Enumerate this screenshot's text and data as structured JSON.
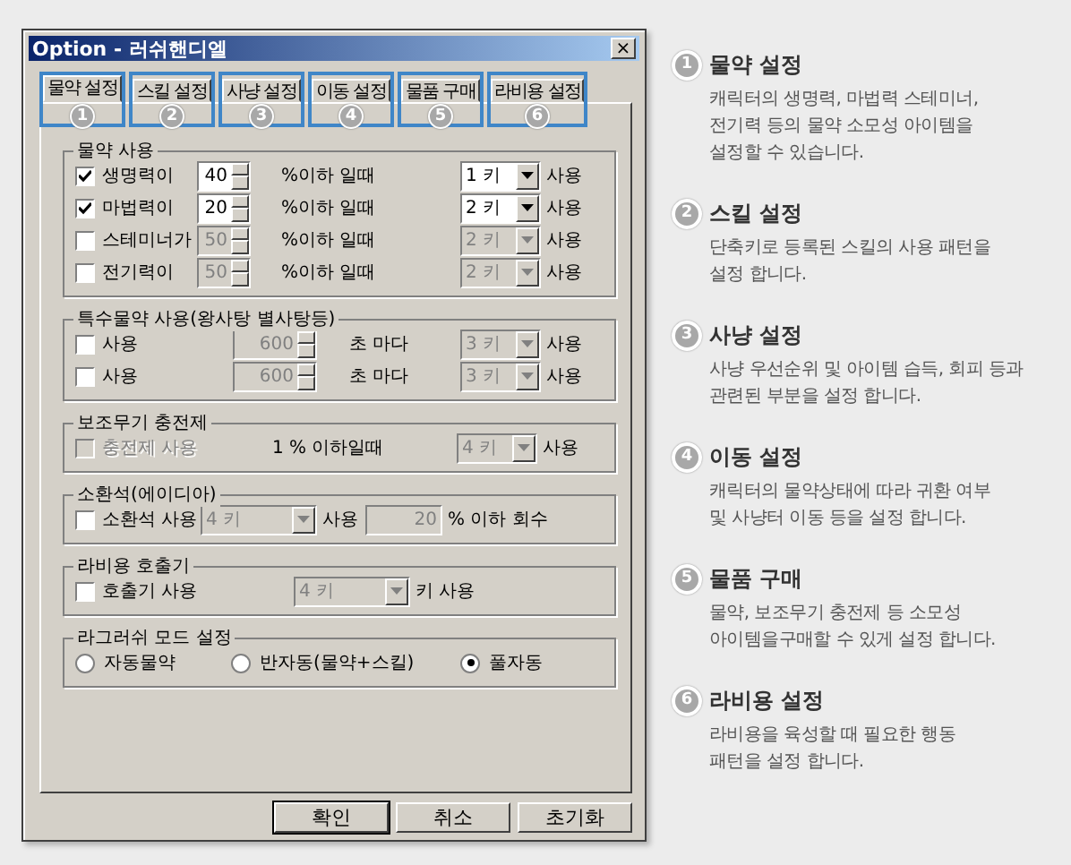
{
  "window": {
    "title": "Option - 러쉬핸디엘",
    "close": "×"
  },
  "tabs": [
    {
      "label": "물약 설정",
      "number": "1",
      "selected": true
    },
    {
      "label": "스킬 설정",
      "number": "2",
      "selected": false
    },
    {
      "label": "사냥 설정",
      "number": "3",
      "selected": false
    },
    {
      "label": "이동 설정",
      "number": "4",
      "selected": false
    },
    {
      "label": "물품 구매",
      "number": "5",
      "selected": false
    },
    {
      "label": "라비용 설정",
      "number": "6",
      "selected": false
    }
  ],
  "groups": [
    {
      "title": "물약 사용",
      "kind": "threshold",
      "rows": [
        {
          "items": [
            {
              "kind": "check",
              "label": "생명력이",
              "checked": true,
              "disabled": false
            },
            {
              "kind": "spin",
              "value": "40",
              "disabled": false
            },
            {
              "kind": "text",
              "text": "%이하 일때"
            },
            {
              "kind": "combo",
              "value": "1 키",
              "disabled": false
            },
            {
              "kind": "text",
              "text": "사용"
            }
          ]
        },
        {
          "items": [
            {
              "kind": "check",
              "label": "마법력이",
              "checked": true,
              "disabled": false
            },
            {
              "kind": "spin",
              "value": "20",
              "disabled": false
            },
            {
              "kind": "text",
              "text": "%이하 일때"
            },
            {
              "kind": "combo",
              "value": "2 키",
              "disabled": false
            },
            {
              "kind": "text",
              "text": "사용"
            }
          ]
        },
        {
          "items": [
            {
              "kind": "check",
              "label": "스테미너가",
              "checked": false,
              "disabled": false
            },
            {
              "kind": "spin",
              "value": "50",
              "disabled": true
            },
            {
              "kind": "text",
              "text": "%이하 일때"
            },
            {
              "kind": "combo",
              "value": "2 키",
              "disabled": true
            },
            {
              "kind": "text",
              "text": "사용"
            }
          ]
        },
        {
          "items": [
            {
              "kind": "check",
              "label": "전기력이",
              "checked": false,
              "disabled": false
            },
            {
              "kind": "spin",
              "value": "50",
              "disabled": true
            },
            {
              "kind": "text",
              "text": "%이하 일때"
            },
            {
              "kind": "combo",
              "value": "2 키",
              "disabled": true
            },
            {
              "kind": "text",
              "text": "사용"
            }
          ]
        }
      ]
    },
    {
      "title": "특수물약 사용(왕사탕 별사탕등)",
      "kind": "timer",
      "rows": [
        {
          "items": [
            {
              "kind": "check",
              "label": "사용",
              "checked": false,
              "disabled": false
            },
            {
              "kind": "spin",
              "value": "600",
              "disabled": true
            },
            {
              "kind": "text",
              "text": "초 마다"
            },
            {
              "kind": "combo",
              "value": "3 키",
              "disabled": true
            },
            {
              "kind": "text",
              "text": "사용"
            }
          ]
        },
        {
          "items": [
            {
              "kind": "check",
              "label": "사용",
              "checked": false,
              "disabled": false
            },
            {
              "kind": "spin",
              "value": "600",
              "disabled": true
            },
            {
              "kind": "text",
              "text": "초 마다"
            },
            {
              "kind": "combo",
              "value": "3 키",
              "disabled": true
            },
            {
              "kind": "text",
              "text": "사용"
            }
          ]
        }
      ]
    },
    {
      "title": "보조무기 충전제",
      "kind": "charge",
      "rows": [
        {
          "items": [
            {
              "kind": "check",
              "label": "충전제 사용",
              "checked": false,
              "disabled": true
            },
            {
              "kind": "text",
              "text": "1 % 이하일때"
            },
            {
              "kind": "combo",
              "value": "4 키",
              "disabled": true
            },
            {
              "kind": "text",
              "text": "사용"
            }
          ]
        }
      ]
    },
    {
      "title": "소환석(에이디아)",
      "kind": "summon",
      "rows": [
        {
          "items": [
            {
              "kind": "check",
              "label": "소환석 사용",
              "checked": false,
              "disabled": false
            },
            {
              "kind": "combo",
              "value": "4 키",
              "disabled": true
            },
            {
              "kind": "text",
              "text": "사용"
            },
            {
              "kind": "field",
              "value": "20",
              "disabled": true
            },
            {
              "kind": "text",
              "text": "% 이하 회수"
            }
          ]
        }
      ]
    },
    {
      "title": "라비용 호출기",
      "kind": "caller",
      "rows": [
        {
          "items": [
            {
              "kind": "check",
              "label": "호출기 사용",
              "checked": false,
              "disabled": false
            },
            {
              "kind": "combo",
              "value": "4 키",
              "disabled": true
            },
            {
              "kind": "text",
              "text": "키 사용"
            }
          ]
        }
      ]
    },
    {
      "title": "라그러쉬 모드 설정",
      "kind": "mode",
      "rows": [
        {
          "items": [
            {
              "kind": "radio",
              "label": "자동물약",
              "selected": false
            },
            {
              "kind": "radio",
              "label": "반자동(물약+스킬)",
              "selected": false
            },
            {
              "kind": "radio",
              "label": "풀자동",
              "selected": true
            }
          ]
        }
      ]
    }
  ],
  "buttons": [
    {
      "label": "확인",
      "focused": true
    },
    {
      "label": "취소",
      "focused": false
    },
    {
      "label": "초기화",
      "focused": false
    }
  ],
  "notes": [
    {
      "number": "1",
      "title": "물약 설정",
      "description": "캐릭터의 생명력, 마법력 스테미너,\n전기력 등의 물약 소모성 아이템을\n설정할 수 있습니다."
    },
    {
      "number": "2",
      "title": "스킬 설정",
      "description": "단축키로 등록된 스킬의 사용 패턴을\n설정 합니다."
    },
    {
      "number": "3",
      "title": "사냥 설정",
      "description": "사냥 우선순위 및 아이템 습득, 회피 등과\n관련된 부분을 설정 합니다."
    },
    {
      "number": "4",
      "title": "이동 설정",
      "description": "캐릭터의 물약상태에 따라 귀환 여부\n및 사냥터 이동 등을 설정 합니다."
    },
    {
      "number": "5",
      "title": "물품 구매",
      "description": "물약, 보조무기 충전제 등 소모성\n아이템을구매할 수 있게 설정 합니다."
    },
    {
      "number": "6",
      "title": "라비용 설정",
      "description": "라비용을 육성할 때 필요한 행동\n패턴을 설정 합니다."
    }
  ]
}
